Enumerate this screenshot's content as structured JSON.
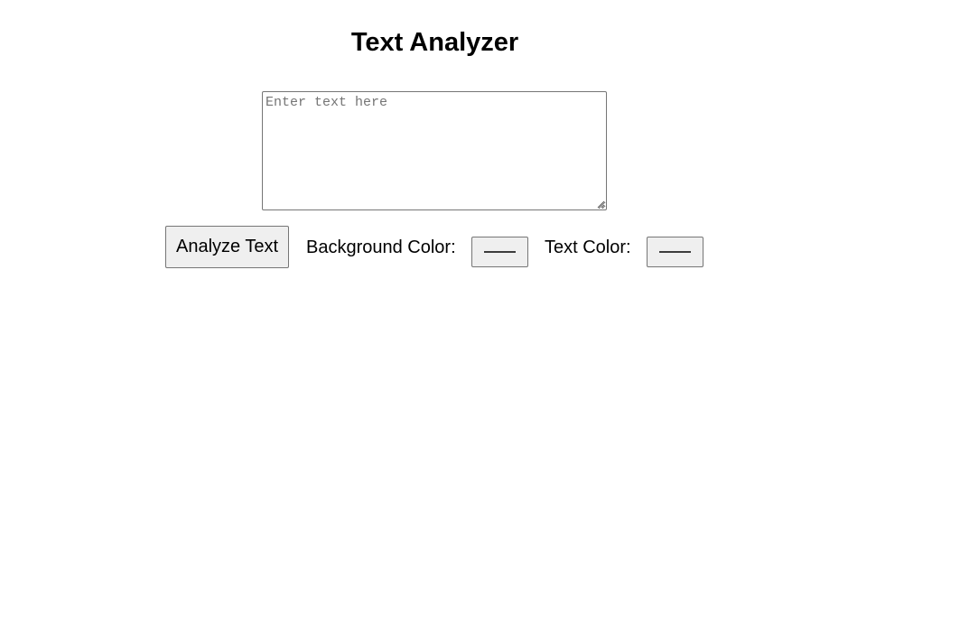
{
  "header": {
    "title": "Text Analyzer"
  },
  "editor": {
    "placeholder": "Enter text here",
    "value": ""
  },
  "controls": {
    "analyze_label": "Analyze Text",
    "background_color_label": "Background Color:",
    "background_color_value": "#000000",
    "text_color_label": "Text Color:",
    "text_color_value": "#000000"
  },
  "colors": {
    "button_face": "#efefef",
    "control_border": "#767676",
    "placeholder_text": "#757575"
  }
}
